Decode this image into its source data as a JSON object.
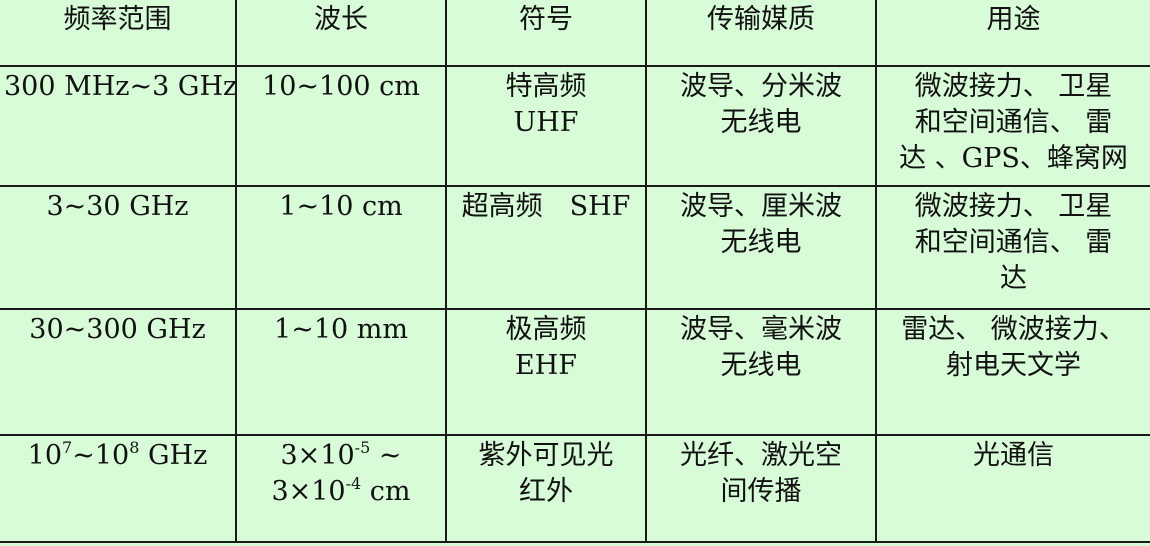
{
  "table": {
    "headers": [
      "频率范围",
      "波长",
      "符号",
      "传输媒质",
      "用途"
    ],
    "rows": [
      {
        "freq": [
          "300 MHz~3 GHz"
        ],
        "wavelength": [
          "10~100 cm"
        ],
        "symbol": [
          "特高频",
          "UHF"
        ],
        "medium": [
          "波导、分米波",
          "无线电"
        ],
        "use": [
          "微波接力、 卫星",
          "和空间通信、 雷",
          "达 、GPS、蜂窝网"
        ]
      },
      {
        "freq": [
          "3~30 GHz"
        ],
        "wavelength": [
          "1~10 cm"
        ],
        "symbol": [
          "超高频　SHF"
        ],
        "medium": [
          "波导、厘米波",
          "无线电"
        ],
        "use": [
          "微波接力、 卫星",
          "和空间通信、 雷",
          "达"
        ]
      },
      {
        "freq": [
          "30~300 GHz"
        ],
        "wavelength": [
          "1~10 mm"
        ],
        "symbol": [
          "极高频",
          "EHF"
        ],
        "medium": [
          "波导、毫米波",
          "无线电"
        ],
        "use": [
          "雷达、 微波接力、",
          "射电天文学"
        ]
      },
      {
        "freq_parts": {
          "a": "10",
          "a_exp": "7",
          "sep": "~10",
          "b_exp": "8",
          "unit": " GHz"
        },
        "wavelength_parts": {
          "l1_pre": "3×10",
          "l1_exp": "-5",
          "l1_post": " ~",
          "l2_pre": "3×10",
          "l2_exp": "-4",
          "l2_post": " cm"
        },
        "symbol": [
          "紫外可见光",
          "红外"
        ],
        "medium": [
          "光纤、激光空",
          "间传播"
        ],
        "use": [
          "光通信"
        ]
      }
    ]
  }
}
